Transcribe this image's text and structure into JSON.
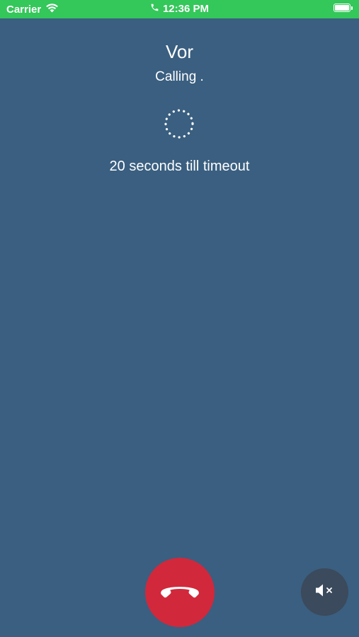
{
  "status_bar": {
    "carrier": "Carrier",
    "time": "12:36 PM",
    "icons": [
      "wifi-icon",
      "phone-icon",
      "battery-icon"
    ]
  },
  "call": {
    "contact_name": "Vor",
    "status": "Calling .",
    "timeout_text": "20 seconds till timeout"
  },
  "controls": {
    "hangup_icon": "phone-hangup-icon",
    "mute_icon": "speaker-muted-icon"
  },
  "colors": {
    "background": "#3a5f80",
    "status_bar": "#34c75a",
    "hangup": "#d2283c",
    "mute": "#3b4a5c"
  }
}
